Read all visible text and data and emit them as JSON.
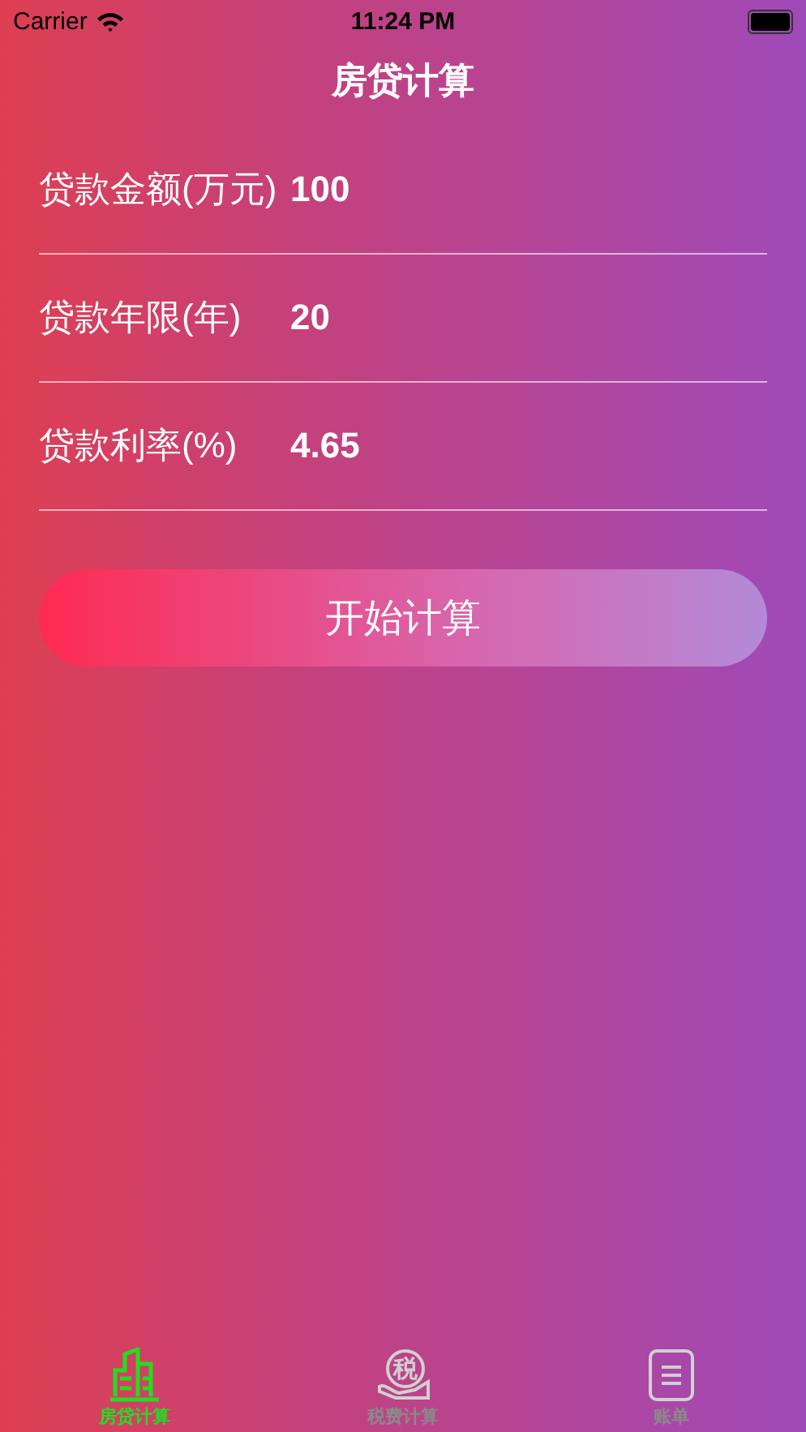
{
  "status_bar": {
    "carrier": "Carrier",
    "time": "11:24 PM"
  },
  "title": "房贷计算",
  "fields": [
    {
      "label": "贷款金额(万元)",
      "value": "100"
    },
    {
      "label": "贷款年限(年)",
      "value": "20"
    },
    {
      "label": "贷款利率(%)",
      "value": "4.65"
    }
  ],
  "button": "开始计算",
  "tabs": [
    {
      "kind": "building",
      "label": "房贷计算",
      "selected": true
    },
    {
      "kind": "tax",
      "label": "税费计算",
      "icon_text": "税",
      "selected": false
    },
    {
      "kind": "list",
      "label": "账单",
      "selected": false
    }
  ]
}
